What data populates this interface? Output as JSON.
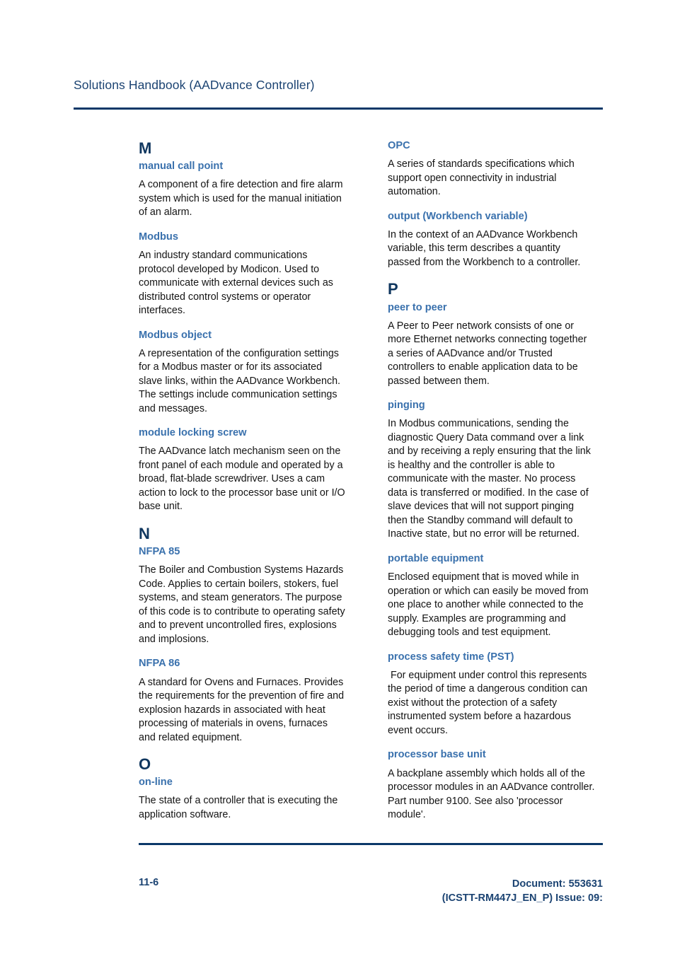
{
  "header": {
    "title": "Solutions Handbook (AADvance Controller)"
  },
  "colors": {
    "rule": "#0b3868",
    "letter_heading": "#10375f",
    "term_heading": "#3a71ad",
    "header_title": "#1b4372",
    "body_text": "#141414"
  },
  "columns": {
    "left": {
      "sections": [
        {
          "letter": "M",
          "entries": [
            {
              "term": "manual call point",
              "definition": "A component of a fire detection and fire alarm system which is used for the manual initiation of an alarm."
            },
            {
              "term": "Modbus",
              "definition": "An industry standard communications protocol developed by Modicon. Used to communicate with external devices such as distributed control systems or operator interfaces."
            },
            {
              "term": "Modbus object",
              "definition": "A representation of the configuration settings for a Modbus master or for its associated slave links, within the AADvance Workbench. The settings include communication settings and messages."
            },
            {
              "term": "module locking screw",
              "definition": "The AADvance latch mechanism seen on the front panel of each module and operated by a broad, flat-blade screwdriver. Uses a cam action to lock to the processor base unit or I/O base unit."
            }
          ]
        },
        {
          "letter": "N",
          "entries": [
            {
              "term": "NFPA 85",
              "definition": "The Boiler and Combustion Systems Hazards Code. Applies to certain boilers, stokers, fuel systems, and steam generators. The purpose of this code is to contribute to operating safety and to prevent uncontrolled fires, explosions and implosions."
            },
            {
              "term": "NFPA 86",
              "definition": "A standard for Ovens and Furnaces. Provides the requirements for the prevention of fire and explosion hazards in associated with heat processing of materials in ovens, furnaces and related equipment."
            }
          ]
        },
        {
          "letter": "O",
          "entries": [
            {
              "term": "on-line",
              "definition": "The state of a controller that is executing the application software."
            }
          ]
        }
      ]
    },
    "right": {
      "sections": [
        {
          "letter": null,
          "entries": [
            {
              "term": "OPC",
              "definition": "A series of standards specifications which support open connectivity in industrial automation."
            },
            {
              "term": "output (Workbench variable)",
              "definition": "In the context of an AADvance Workbench variable, this term describes a quantity passed from the Workbench to a controller."
            }
          ]
        },
        {
          "letter": "P",
          "entries": [
            {
              "term": "peer to peer",
              "definition": "A Peer to Peer network consists of one or more Ethernet networks connecting together a series of AADvance and/or Trusted controllers to enable application data to be passed between them."
            },
            {
              "term": "pinging",
              "definition": "In Modbus communications, sending the diagnostic Query Data command over a link and by receiving a reply ensuring that the link is healthy and the controller is able to communicate with the master. No process data is transferred or modified. In the case of slave devices that will not support pinging then the Standby command will default to Inactive state, but no error will be returned."
            },
            {
              "term": "portable equipment",
              "definition": "Enclosed equipment that is moved while in operation or which can easily be moved from one place to another while connected to the supply. Examples are programming and debugging tools and test equipment."
            },
            {
              "term": "process safety time (PST)",
              "definition": " For equipment under control this represents the period of time a dangerous condition can exist without the protection of a safety instrumented system before a hazardous event occurs."
            },
            {
              "term": "processor base unit",
              "definition": "A backplane assembly which holds all of the processor modules in an AADvance controller. Part number 9100. See also 'processor module'."
            }
          ]
        }
      ]
    }
  },
  "footer": {
    "page_number": "11-6",
    "document_line1": "Document: 553631",
    "document_line2": "(ICSTT-RM447J_EN_P) Issue: 09:"
  }
}
